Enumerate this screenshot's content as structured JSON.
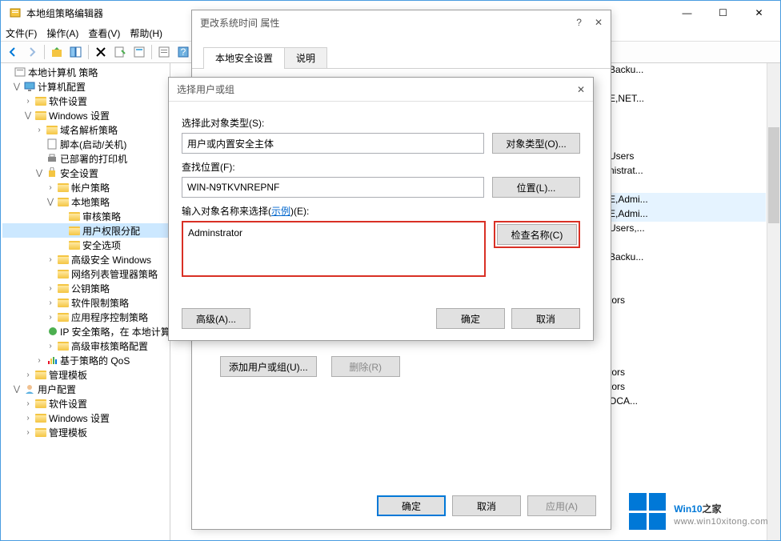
{
  "window": {
    "title": "本地组策略编辑器",
    "controls": {
      "min": "—",
      "max": "☐",
      "close": "✕"
    }
  },
  "menu": {
    "file": "文件(F)",
    "action": "操作(A)",
    "view": "查看(V)",
    "help": "帮助(H)"
  },
  "tree": {
    "root": "本地计算机 策略",
    "computer_config": "计算机配置",
    "software_settings": "软件设置",
    "windows_settings": "Windows 设置",
    "dns_policy": "域名解析策略",
    "scripts": "脚本(启动/关机)",
    "printers": "已部署的打印机",
    "security": "安全设置",
    "account_policy": "帐户策略",
    "local_policy": "本地策略",
    "audit_policy": "审核策略",
    "user_rights": "用户权限分配",
    "security_options": "安全选项",
    "advanced_firewall": "高级安全 Windows",
    "network_list": "网络列表管理器策略",
    "public_key": "公钥策略",
    "software_restrict": "软件限制策略",
    "app_control": "应用程序控制策略",
    "ip_security": "IP 安全策略，在 本地计算",
    "advanced_audit": "高级审核策略配置",
    "qos": "基于策略的 QoS",
    "admin_templates1": "管理模板",
    "user_config": "用户配置",
    "software_settings2": "软件设置",
    "windows_settings2": "Windows 设置",
    "admin_templates2": "管理模板"
  },
  "right_items": [
    "Backu...",
    "",
    "E,NET...",
    "",
    "",
    "",
    "Users",
    "nistrat...",
    "",
    "E,Admi...",
    "E,Admi...",
    "Users,...",
    "",
    "Backu...",
    "",
    "",
    "tors",
    "",
    "",
    "",
    "",
    "tors",
    "tors",
    "OCA..."
  ],
  "props_dialog": {
    "title": "更改系统时间 属性",
    "tab1": "本地安全设置",
    "tab2": "说明",
    "add_user": "添加用户或组(U)...",
    "delete": "删除(R)",
    "ok": "确定",
    "cancel": "取消",
    "apply": "应用(A)"
  },
  "select_dialog": {
    "title": "选择用户或组",
    "object_type_label": "选择此对象类型(S):",
    "object_type_value": "用户或内置安全主体",
    "object_types_btn": "对象类型(O)...",
    "location_label": "查找位置(F):",
    "location_value": "WIN-N9TKVNREPNF",
    "location_btn": "位置(L)...",
    "names_label_pre": "输入对象名称来选择(",
    "names_label_link": "示例",
    "names_label_post": ")(E):",
    "names_value": "Adminstrator",
    "check_names": "检查名称(C)",
    "advanced": "高级(A)...",
    "ok": "确定",
    "cancel": "取消"
  },
  "watermark": {
    "brand_pre": "Win10",
    "brand_post": "之家",
    "url": "www.win10xitong.com"
  }
}
